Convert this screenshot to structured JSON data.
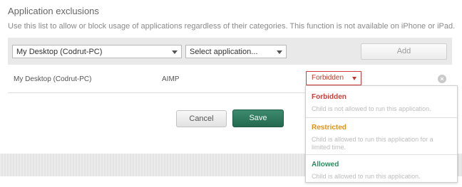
{
  "section": {
    "title": "Application exclusions",
    "description": "Use this list to allow or block usage of applications regardless of their categories. This function is not available on iPhone or iPad."
  },
  "toolbar": {
    "device_select_value": "My Desktop (Codrut-PC)",
    "app_select_value": "Select application...",
    "add_label": "Add"
  },
  "exclusion_row": {
    "device": "My Desktop (Codrut-PC)",
    "application": "AIMP",
    "status": "Forbidden"
  },
  "status_options": [
    {
      "label": "Forbidden",
      "description": "Child is not allowed to run this application."
    },
    {
      "label": "Restricted",
      "description": "Child is allowed to run this application for a limited time."
    },
    {
      "label": "Allowed",
      "description": "Child is allowed to run this application."
    }
  ],
  "actions": {
    "cancel_label": "Cancel",
    "save_label": "Save"
  },
  "colors": {
    "forbidden": "#c7403a",
    "restricted": "#e0921a",
    "allowed": "#2e8b5f",
    "save_button": "#2f7a5e",
    "toolbar_bg": "#e9e9e9"
  },
  "icons": {
    "remove": "remove-circle-icon",
    "select_arrow": "chevron-down-icon"
  }
}
